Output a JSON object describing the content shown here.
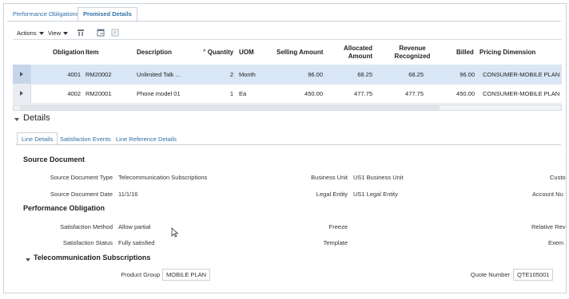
{
  "tabs": [
    "Performance Obligations",
    "Promised Details"
  ],
  "toolbar": {
    "actions": "Actions",
    "view": "View"
  },
  "table": {
    "headers": {
      "obligation": "Obligation",
      "item": "Item",
      "description": "Description",
      "quantity": "Quantity",
      "uom": "UOM",
      "selling_amount": "Selling Amount",
      "allocated_amount_1": "Allocated",
      "allocated_amount_2": "Amount",
      "revenue_recognized_1": "Revenue",
      "revenue_recognized_2": "Recognized",
      "billed": "Billed",
      "pricing_dimension": "Pricing Dimension"
    },
    "rows": [
      {
        "obligation": "4001",
        "item": "RM20002",
        "description": "Unlimited Talk ...",
        "quantity": "2",
        "uom": "Month",
        "selling_amount": "96.00",
        "allocated_amount": "68.25",
        "revenue_recognized": "68.25",
        "billed": "96.00",
        "pricing_dimension": "CONSUMER-MOBILE PLAN"
      },
      {
        "obligation": "4002",
        "item": "RM20001",
        "description": "Phone model 01",
        "quantity": "1",
        "uom": "Ea",
        "selling_amount": "450.00",
        "allocated_amount": "477.75",
        "revenue_recognized": "477.75",
        "billed": "450.00",
        "pricing_dimension": "CONSUMER-MOBILE PLAN"
      }
    ]
  },
  "details": {
    "title": "Details",
    "tabs": [
      "Line Details",
      "Satisfaction Events",
      "Line Reference Details"
    ],
    "source_document": {
      "heading": "Source Document",
      "type_label": "Source Document Type",
      "type_value": "Telecommunication Subscriptions",
      "date_label": "Source Document Date",
      "date_value": "11/1/16",
      "business_unit_label": "Business Unit",
      "business_unit_value": "US1 Business Unit",
      "legal_entity_label": "Legal Entity",
      "legal_entity_value": "US1 Legal Entity",
      "customer_label_cut": "Custo",
      "account_label_cut": "Account Nu"
    },
    "performance_obligation": {
      "heading": "Performance Obligation",
      "method_label": "Satisfaction Method",
      "method_value": "Allow partial",
      "status_label": "Satisfaction Status",
      "status_value": "Fully satisfied",
      "freeze_label": "Freeze",
      "template_label": "Template",
      "relative_label_cut": "Relative Rev",
      "exempt_label_cut": "Exem"
    },
    "telecom": {
      "heading": "Telecommunication Subscriptions",
      "product_group_label": "Product Group",
      "product_group_value": "MOBILE PLAN",
      "quote_number_label": "Quote Number",
      "quote_number_value": "QTE105001"
    }
  }
}
